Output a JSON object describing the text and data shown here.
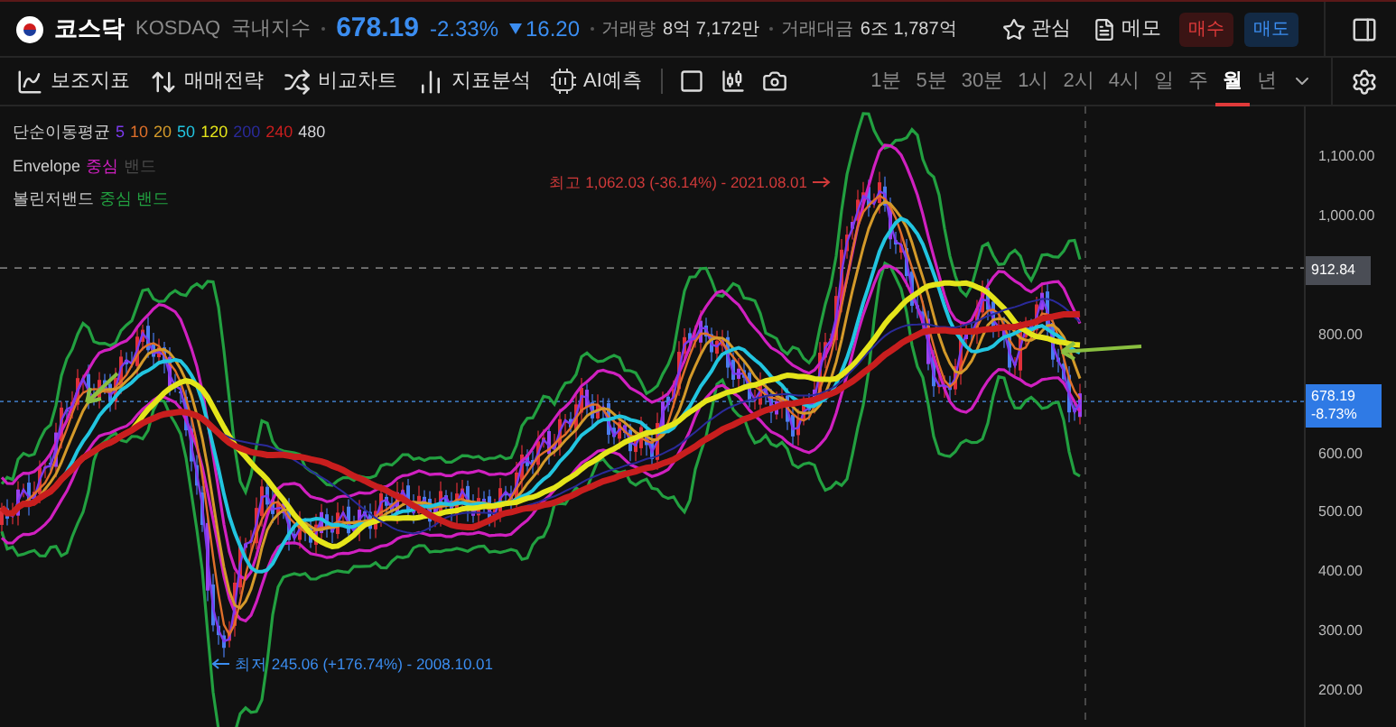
{
  "header": {
    "name": "코스닥",
    "code": "KOSDAQ",
    "market": "국내지수",
    "price": "678.19",
    "change_pct": "-2.33%",
    "change": "16.20",
    "stats": [
      {
        "label": "거래량",
        "value": "8억 7,172만"
      },
      {
        "label": "거래대금",
        "value": "6조 1,787억"
      }
    ],
    "actions": [
      {
        "kind": "watch",
        "label": "관심"
      },
      {
        "kind": "memo",
        "label": "메모"
      },
      {
        "kind": "buy",
        "label": "매수"
      },
      {
        "kind": "sell",
        "label": "매도"
      }
    ]
  },
  "toolbar": {
    "tools": [
      {
        "kind": "indicator",
        "label": "보조지표"
      },
      {
        "kind": "strategy",
        "label": "매매전략"
      },
      {
        "kind": "compare",
        "label": "비교차트"
      },
      {
        "kind": "analysis",
        "label": "지표분석"
      },
      {
        "kind": "ai",
        "label": "AI예측"
      }
    ],
    "intervals": [
      {
        "label": "1분",
        "selected": false
      },
      {
        "label": "5분",
        "selected": false
      },
      {
        "label": "30분",
        "selected": false
      },
      {
        "label": "1시",
        "selected": false
      },
      {
        "label": "2시",
        "selected": false
      },
      {
        "label": "4시",
        "selected": false
      },
      {
        "label": "일",
        "selected": false
      },
      {
        "label": "주",
        "selected": false
      },
      {
        "label": "월",
        "selected": true
      },
      {
        "label": "년",
        "selected": false
      }
    ]
  },
  "legend": [
    {
      "title": "단순이동평균",
      "items": [
        {
          "label": "5",
          "color": "#7c3aed"
        },
        {
          "label": "10",
          "color": "#e0702a"
        },
        {
          "label": "20",
          "color": "#d49a2a"
        },
        {
          "label": "50",
          "color": "#22c5e0"
        },
        {
          "label": "120",
          "color": "#e5e51a"
        },
        {
          "label": "200",
          "color": "#2a2a9a"
        },
        {
          "label": "240",
          "color": "#c81e1e"
        },
        {
          "label": "480",
          "color": "#d4d4d8"
        }
      ]
    },
    {
      "title": "Envelope",
      "items": [
        {
          "label": "중심",
          "color": "#d020c0"
        },
        {
          "label": "밴드",
          "color": "#4a4a4a"
        }
      ]
    },
    {
      "title": "볼린저밴드",
      "items": [
        {
          "label": "중심 밴드",
          "color": "#22a040"
        }
      ]
    }
  ],
  "annotations": {
    "high": "최고 1,062.03 (-36.14%) - 2021.08.01",
    "low": "최저 245.06 (+176.74%) - 2008.10.01"
  },
  "axis": {
    "ticks": [
      "1,100.00",
      "1,000.00",
      "800.00",
      "600.00",
      "500.00",
      "400.00",
      "300.00",
      "200.00"
    ],
    "marker": "912.84",
    "last_price": "678.19",
    "last_change": "-8.73%"
  }
}
